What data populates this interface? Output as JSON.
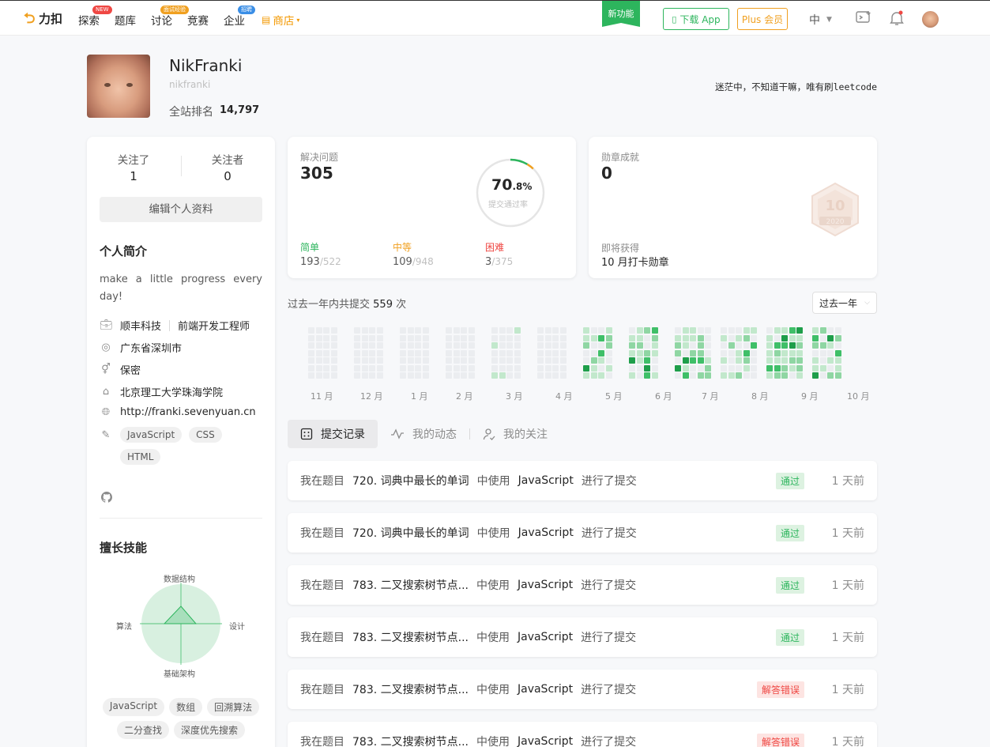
{
  "nav": {
    "logo": "力扣",
    "items": [
      {
        "label": "探索",
        "badge": "NEW",
        "badge_color": "#ef4743"
      },
      {
        "label": "题库",
        "badge": "",
        "badge_color": ""
      },
      {
        "label": "讨论",
        "badge": "面试经验",
        "badge_color": "#f0a020"
      },
      {
        "label": "竞赛",
        "badge": "",
        "badge_color": ""
      },
      {
        "label": "企业",
        "badge": "招聘",
        "badge_color": "#3a8ee6"
      }
    ],
    "shop": "商店",
    "new_feature": "新功能",
    "download_app": "下载 App",
    "plus": "Plus 会员",
    "lang": "中"
  },
  "profile": {
    "name": "NikFranki",
    "slug": "nikfranki",
    "rank_label": "全站排名",
    "rank_value": "14,797",
    "motto": "迷茫中，不知道干嘛，唯有刷leetcode"
  },
  "sidebar": {
    "following_label": "关注了",
    "following_value": "1",
    "followers_label": "关注者",
    "followers_value": "0",
    "edit_label": "编辑个人资料",
    "bio_title": "个人简介",
    "bio": "make a little progress every day!",
    "company": "顺丰科技",
    "job": "前端开发工程师",
    "location": "广东省深圳市",
    "gender": "保密",
    "school": "北京理工大学珠海学院",
    "website": "http://franki.sevenyuan.cn",
    "tags": [
      "JavaScript",
      "CSS",
      "HTML"
    ],
    "skills_title": "擅长技能",
    "radar": {
      "top": "数据结构",
      "right": "设计",
      "bottom": "基础架构",
      "left": "算法"
    },
    "skill_tags": [
      "JavaScript",
      "数组",
      "回溯算法",
      "二分查找",
      "深度优先搜索"
    ]
  },
  "solved": {
    "title": "解决问题",
    "count": "305",
    "rate_int": "70",
    "rate_dec": ".8%",
    "rate_label": "提交通过率",
    "rate_value": 70.8,
    "easy_label": "简单",
    "easy_solved": "193",
    "easy_total": "/522",
    "medium_label": "中等",
    "medium_solved": "109",
    "medium_total": "/948",
    "hard_label": "困难",
    "hard_solved": "3",
    "hard_total": "/375",
    "colors": {
      "easy": "#2db55d",
      "medium": "#f0a020",
      "hard": "#ef4743"
    }
  },
  "badges": {
    "title": "勋章成就",
    "count": "0",
    "upcoming_label": "即将获得",
    "upcoming_name": "10 月打卡勋章",
    "badge_text": "10",
    "badge_year": "2020"
  },
  "heatmap": {
    "summary_prefix": "过去一年内共提交",
    "summary_count": "559",
    "summary_suffix": "次",
    "range_select": "过去一年",
    "months": [
      "11 月",
      "12 月",
      "1 月",
      "2 月",
      "3 月",
      "4 月",
      "5 月",
      "6 月",
      "7 月",
      "8 月",
      "9 月",
      "10 月"
    ]
  },
  "tabs": [
    {
      "label": "提交记录",
      "icon": "calendar-icon"
    },
    {
      "label": "我的动态",
      "icon": "activity-icon"
    },
    {
      "label": "我的关注",
      "icon": "user-follow-icon"
    }
  ],
  "submissions": [
    {
      "prefix": "我在题目",
      "problem": "720. 词典中最长的单词",
      "mid": "中使用",
      "lang": "JavaScript",
      "suffix": "进行了提交",
      "status": "通过",
      "ok": true,
      "time": "1 天前"
    },
    {
      "prefix": "我在题目",
      "problem": "720. 词典中最长的单词",
      "mid": "中使用",
      "lang": "JavaScript",
      "suffix": "进行了提交",
      "status": "通过",
      "ok": true,
      "time": "1 天前"
    },
    {
      "prefix": "我在题目",
      "problem": "783. 二叉搜索树节点...",
      "mid": "中使用",
      "lang": "JavaScript",
      "suffix": "进行了提交",
      "status": "通过",
      "ok": true,
      "time": "1 天前"
    },
    {
      "prefix": "我在题目",
      "problem": "783. 二叉搜索树节点...",
      "mid": "中使用",
      "lang": "JavaScript",
      "suffix": "进行了提交",
      "status": "通过",
      "ok": true,
      "time": "1 天前"
    },
    {
      "prefix": "我在题目",
      "problem": "783. 二叉搜索树节点...",
      "mid": "中使用",
      "lang": "JavaScript",
      "suffix": "进行了提交",
      "status": "解答错误",
      "ok": false,
      "time": "1 天前"
    },
    {
      "prefix": "我在题目",
      "problem": "783. 二叉搜索树节点...",
      "mid": "中使用",
      "lang": "JavaScript",
      "suffix": "进行了提交",
      "status": "解答错误",
      "ok": false,
      "time": "1 天前"
    }
  ]
}
